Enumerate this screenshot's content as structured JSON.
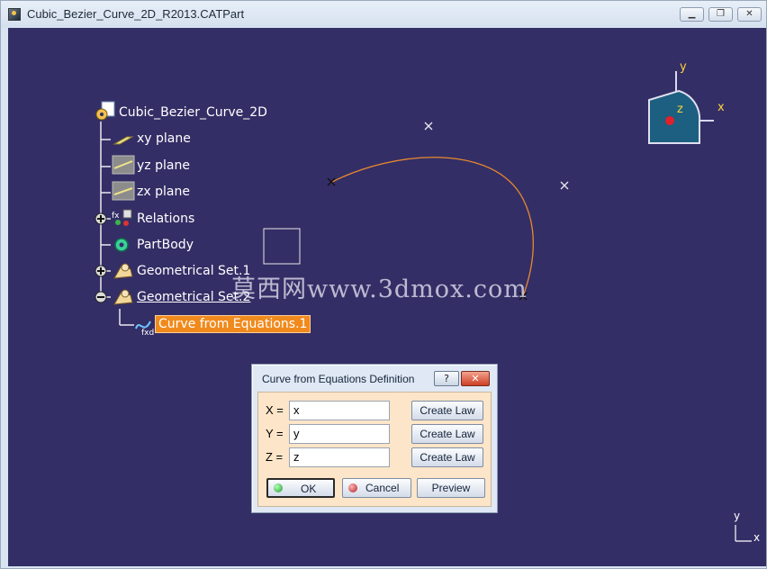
{
  "window": {
    "title": "Cubic_Bezier_Curve_2D_R2013.CATPart",
    "controls": [
      "minimize",
      "restore",
      "close"
    ]
  },
  "tree": {
    "root": "Cubic_Bezier_Curve_2D",
    "items": [
      {
        "label": "xy plane",
        "icon": "plane-icon"
      },
      {
        "label": "yz plane",
        "icon": "plane-icon"
      },
      {
        "label": "zx plane",
        "icon": "plane-icon"
      },
      {
        "label": "Relations",
        "icon": "relations-icon"
      },
      {
        "label": "PartBody",
        "icon": "partbody-gear-icon"
      },
      {
        "label": "Geometrical Set.1",
        "icon": "geometrical-set-icon"
      },
      {
        "label": "Geometrical Set.2",
        "icon": "geometrical-set-icon"
      },
      {
        "label": "Curve from Equations.1",
        "icon": "curve-equation-icon"
      }
    ]
  },
  "compass": {
    "x_label": "x",
    "y_label": "y",
    "z_label": "z"
  },
  "axis_indicator": {
    "x_label": "x",
    "y_label": "y"
  },
  "watermark": "莫西网www.3dmox.com",
  "dialog": {
    "title": "Curve from Equations Definition",
    "help_label": "?",
    "close_label": "✕",
    "fields": [
      {
        "label": "X =",
        "value": "x",
        "button": "Create Law"
      },
      {
        "label": "Y =",
        "value": "y",
        "button": "Create Law"
      },
      {
        "label": "Z =",
        "value": "z",
        "button": "Create Law"
      }
    ],
    "ok_label": "OK",
    "cancel_label": "Cancel",
    "preview_label": "Preview"
  },
  "colors": {
    "viewport_bg": "#342e66",
    "selection": "#f08a1c",
    "curve": "#e98a2e",
    "dialog_body": "#fce5c8"
  }
}
